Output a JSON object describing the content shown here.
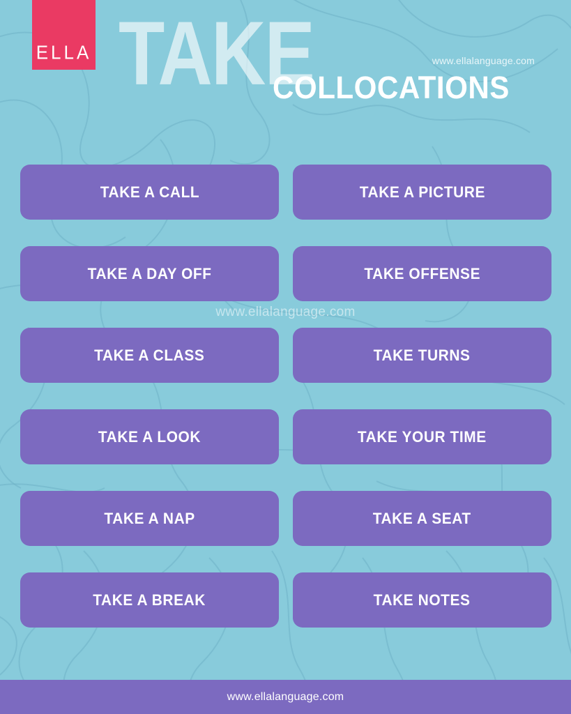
{
  "poster": {
    "background_color": "#88cbdb",
    "accent_purple": "#7c6ac0",
    "accent_pink": "#ea3a63"
  },
  "header": {
    "logo_text": "ELLA",
    "title_main": "TAKE",
    "title_sub": "COLLOCATIONS",
    "url": "www.ellalanguage.com"
  },
  "watermark": {
    "center_text": "www.ellalanguage.com"
  },
  "footer": {
    "url": "www.ellalanguage.com"
  },
  "collocations": [
    {
      "left": "TAKE A CALL",
      "right": "TAKE A PICTURE"
    },
    {
      "left": "TAKE A DAY OFF",
      "right": "TAKE OFFENSE"
    },
    {
      "left": "TAKE A CLASS",
      "right": "TAKE TURNS"
    },
    {
      "left": "TAKE A LOOK",
      "right": "TAKE YOUR TIME"
    },
    {
      "left": "TAKE A NAP",
      "right": "TAKE A SEAT"
    },
    {
      "left": "TAKE A BREAK",
      "right": "TAKE NOTES"
    }
  ],
  "chips": [
    "TAKE A CALL",
    "TAKE A PICTURE",
    "TAKE A DAY OFF",
    "TAKE OFFENSE",
    "TAKE A CLASS",
    "TAKE TURNS",
    "TAKE A LOOK",
    "TAKE YOUR TIME",
    "TAKE A NAP",
    "TAKE A SEAT",
    "TAKE A BREAK",
    "TAKE NOTES"
  ]
}
